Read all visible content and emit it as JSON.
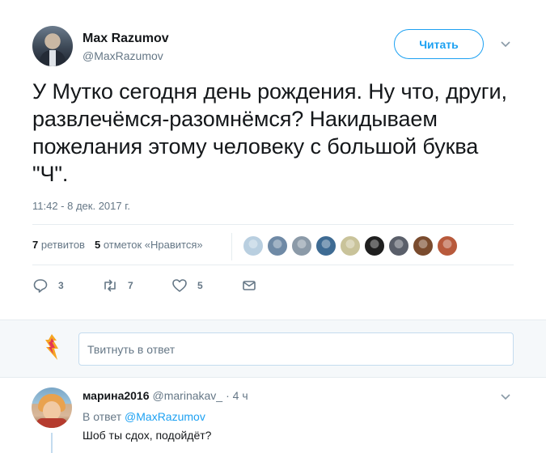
{
  "tweet": {
    "author_name": "Max Razumov",
    "author_handle": "@MaxRazumov",
    "follow_label": "Читать",
    "text": "У Мутко сегодня день рождения. Ну что, други, развлечёмся-разомнёмся? Накидываем пожелания этому человеку с большой буква \"Ч\".",
    "timestamp": "11:42 - 8 дек. 2017 г.",
    "retweet_count": "7",
    "retweet_label": "ретвитов",
    "like_count": "5",
    "like_label": "отметок «Нравится»",
    "likers": [
      {
        "icon": "liker-avatar",
        "color": "#b9cfe0"
      },
      {
        "icon": "liker-avatar",
        "color": "#6f8aa6"
      },
      {
        "icon": "liker-avatar",
        "color": "#8b9aa8"
      },
      {
        "icon": "liker-avatar",
        "color": "#3e6b93"
      },
      {
        "icon": "liker-avatar",
        "color": "#c9c39a"
      },
      {
        "icon": "liker-avatar",
        "color": "#1f1f1f"
      },
      {
        "icon": "liker-avatar",
        "color": "#5a5f6a"
      },
      {
        "icon": "liker-avatar",
        "color": "#7a4b2e"
      },
      {
        "icon": "liker-avatar",
        "color": "#b85a3c"
      }
    ],
    "actions": {
      "reply_count": "3",
      "retweet_count": "7",
      "like_count": "5"
    }
  },
  "reply_box": {
    "placeholder": "Твитнуть в ответ"
  },
  "reply": {
    "name": "марина2016",
    "handle": "@marinakav_",
    "time": "· 4 ч",
    "in_reply_prefix": "В ответ",
    "in_reply_handle": "@MaxRazumov",
    "text": "Шоб ты сдох, подойдёт?"
  },
  "colors": {
    "accent": "#1da1f2",
    "secondary_text": "#657786",
    "divider": "#e6ecf0"
  }
}
